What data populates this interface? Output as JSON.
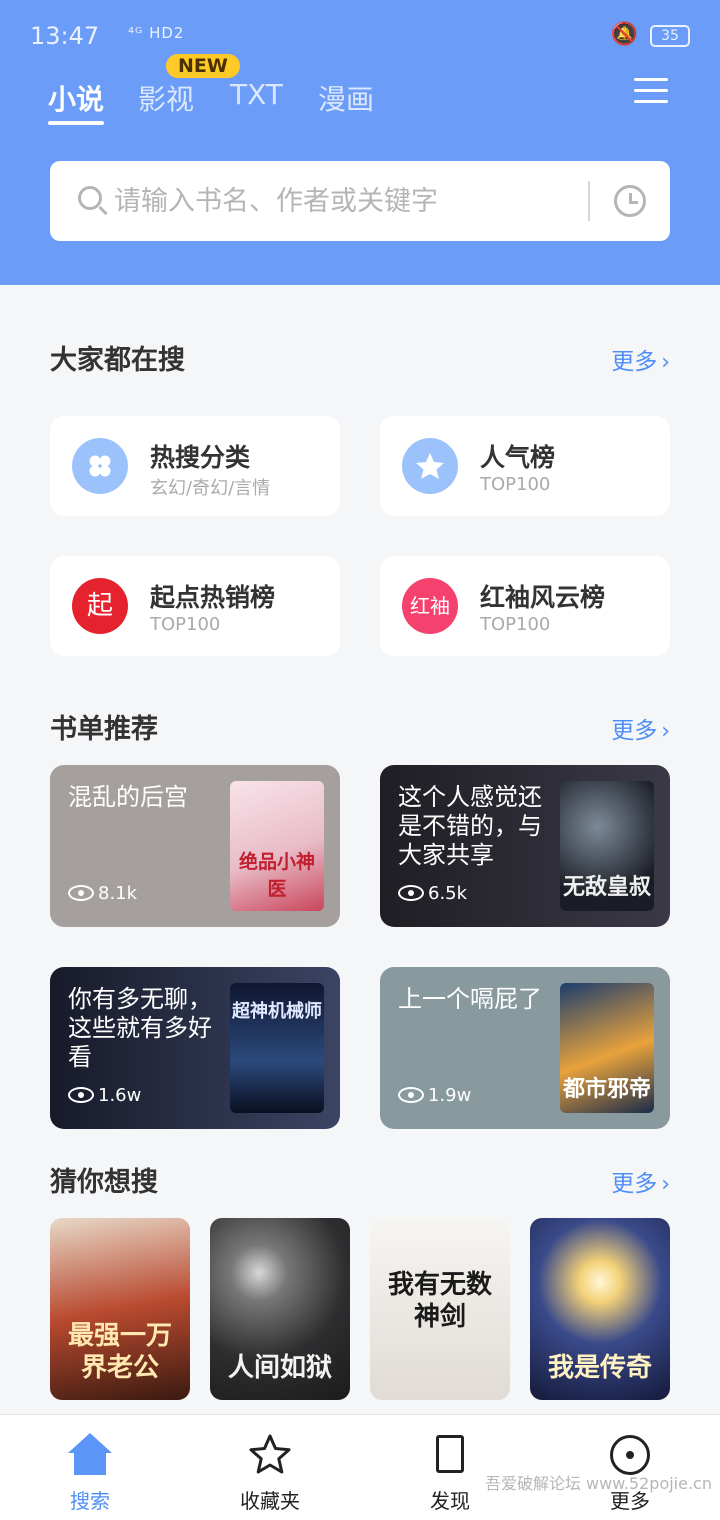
{
  "status_bar": {
    "time": "13:47",
    "network": "⁴ᴳ HD2",
    "battery": "35"
  },
  "tabs": [
    {
      "label": "小说",
      "active": true
    },
    {
      "label": "影视",
      "badge": "NEW"
    },
    {
      "label": "TXT"
    },
    {
      "label": "漫画"
    }
  ],
  "search": {
    "placeholder": "请输入书名、作者或关键字"
  },
  "hot_section": {
    "title": "大家都在搜",
    "more": "更多"
  },
  "rank_cards": [
    {
      "title": "热搜分类",
      "subtitle": "玄幻/奇幻/言情",
      "icon": "grid-icon",
      "icon_color": "#9cc2fb"
    },
    {
      "title": "人气榜",
      "subtitle": "TOP100",
      "icon": "star-icon",
      "icon_color": "#9cc2fb"
    },
    {
      "title": "起点热销榜",
      "subtitle": "TOP100",
      "icon_text": "起",
      "icon_color": "#e5232f"
    },
    {
      "title": "红袖风云榜",
      "subtitle": "TOP100",
      "icon_text": "红袖",
      "icon_color": "#f5416d"
    }
  ],
  "booklist_section": {
    "title": "书单推荐",
    "more": "更多"
  },
  "booklists": [
    {
      "title": "混乱的后宫",
      "views": "8.1k",
      "bg": "#a59f9e",
      "cover_text": "绝品小神医"
    },
    {
      "title": "这个人感觉还是不错的，与大家共享",
      "views": "6.5k",
      "bg": "#2c2b34",
      "cover_text": "无敌皇叔"
    },
    {
      "title": "你有多无聊，这些就有多好看",
      "views": "1.6w",
      "bg": "#22273b",
      "cover_text": "超神机械师"
    },
    {
      "title": "上一个嗝屁了",
      "views": "1.9w",
      "bg": "#889a9e",
      "cover_text": "都市邪帝"
    }
  ],
  "guess_section": {
    "title": "猜你想搜",
    "more": "更多"
  },
  "guess_books": [
    {
      "cover_text": "最强一万界老公",
      "bg": "#b94a30"
    },
    {
      "cover_text": "人间如狱",
      "bg": "#3b3b3d"
    },
    {
      "cover_text": "我有无数神剑",
      "bg": "#e8e4df"
    },
    {
      "cover_text": "我是传奇",
      "bg": "#27326b"
    }
  ],
  "bottom_nav": [
    {
      "label": "搜索",
      "active": true
    },
    {
      "label": "收藏夹"
    },
    {
      "label": "发现"
    },
    {
      "label": "更多"
    }
  ],
  "watermark": "吾爱破解论坛 www.52pojie.cn"
}
